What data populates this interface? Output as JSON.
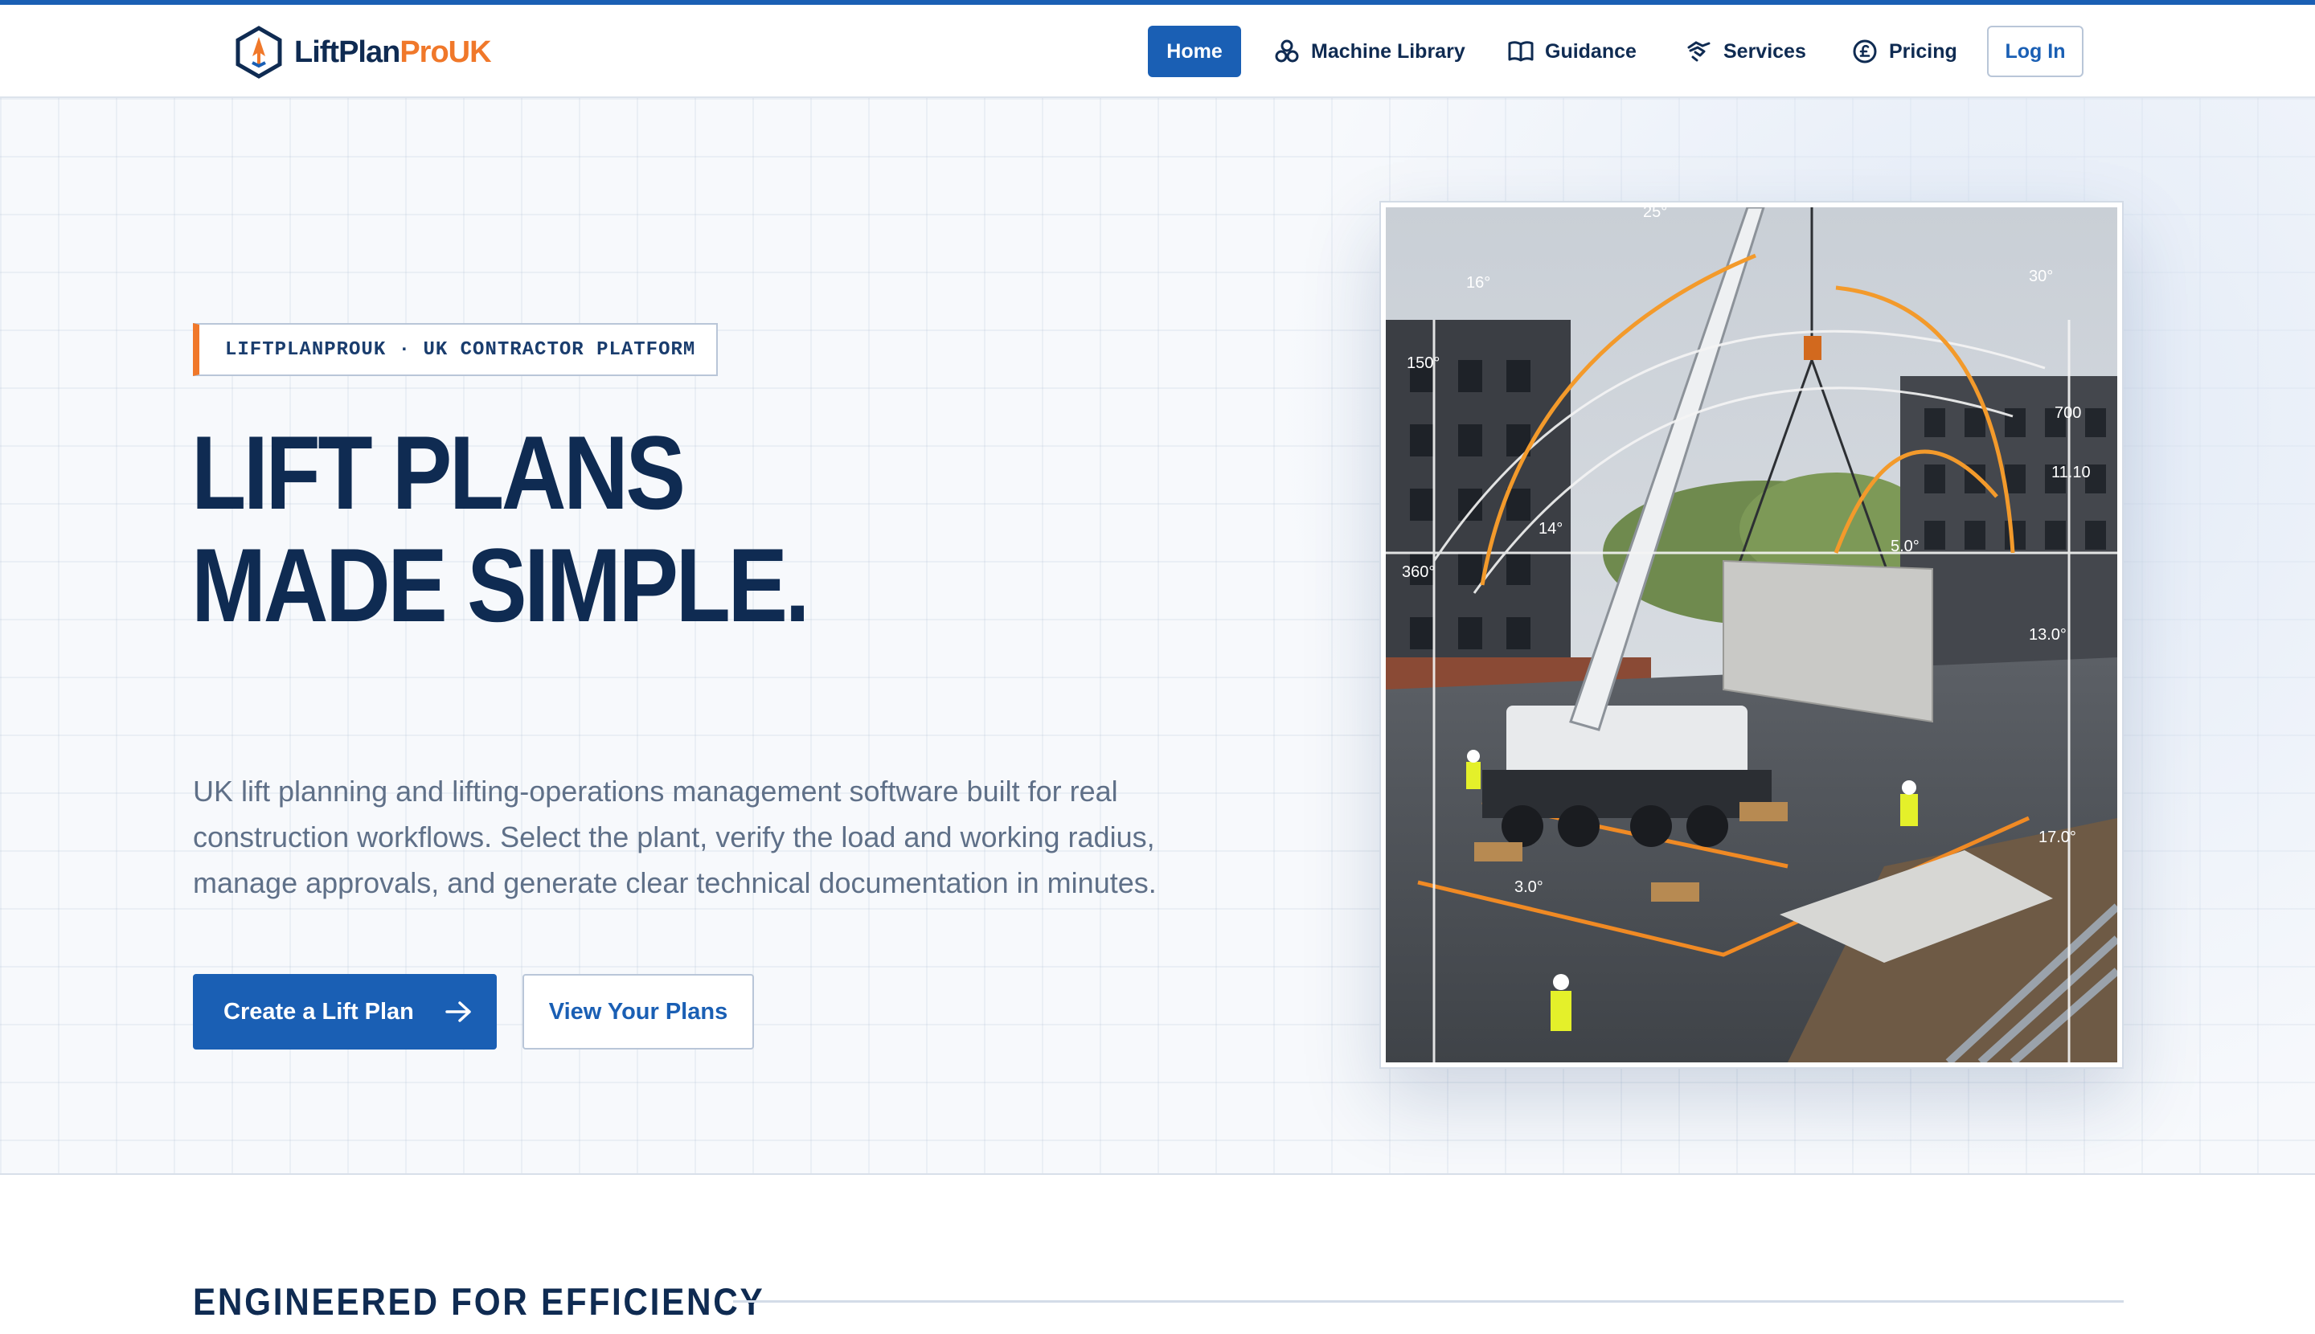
{
  "brand": {
    "name_part1": "LiftPlan",
    "name_part2": "ProUK",
    "primary": "#1a5fb4",
    "accent": "#f0782a",
    "navy": "#0f2b52"
  },
  "nav": {
    "items": [
      {
        "label": "Home",
        "icon": ""
      },
      {
        "label": "Machine Library",
        "icon": "machine-library-icon"
      },
      {
        "label": "Guidance",
        "icon": "book-icon"
      },
      {
        "label": "Services",
        "icon": "services-icon"
      },
      {
        "label": "Pricing",
        "icon": "pound-icon"
      }
    ],
    "login_label": "Log In"
  },
  "hero": {
    "badge": "LIFTPLANPROUK · UK CONTRACTOR PLATFORM",
    "headline_line1": "LIFT PLANS",
    "headline_line2": "MADE SIMPLE.",
    "subtitle": "UK lift planning and lifting-operations management software built for real construction workflows. Select the plant, verify the load and working radius, manage approvals, and generate clear technical documentation in minutes.",
    "primary_cta": "Create a Lift Plan",
    "secondary_cta": "View Your Plans",
    "image_annotations": [
      "150°",
      "16°",
      "25°",
      "30°",
      "14°",
      "5.0°",
      "13.0°",
      "360°",
      "700",
      "11.10",
      "17.0°",
      "3.0°"
    ]
  },
  "section": {
    "title": "ENGINEERED FOR EFFICIENCY"
  }
}
